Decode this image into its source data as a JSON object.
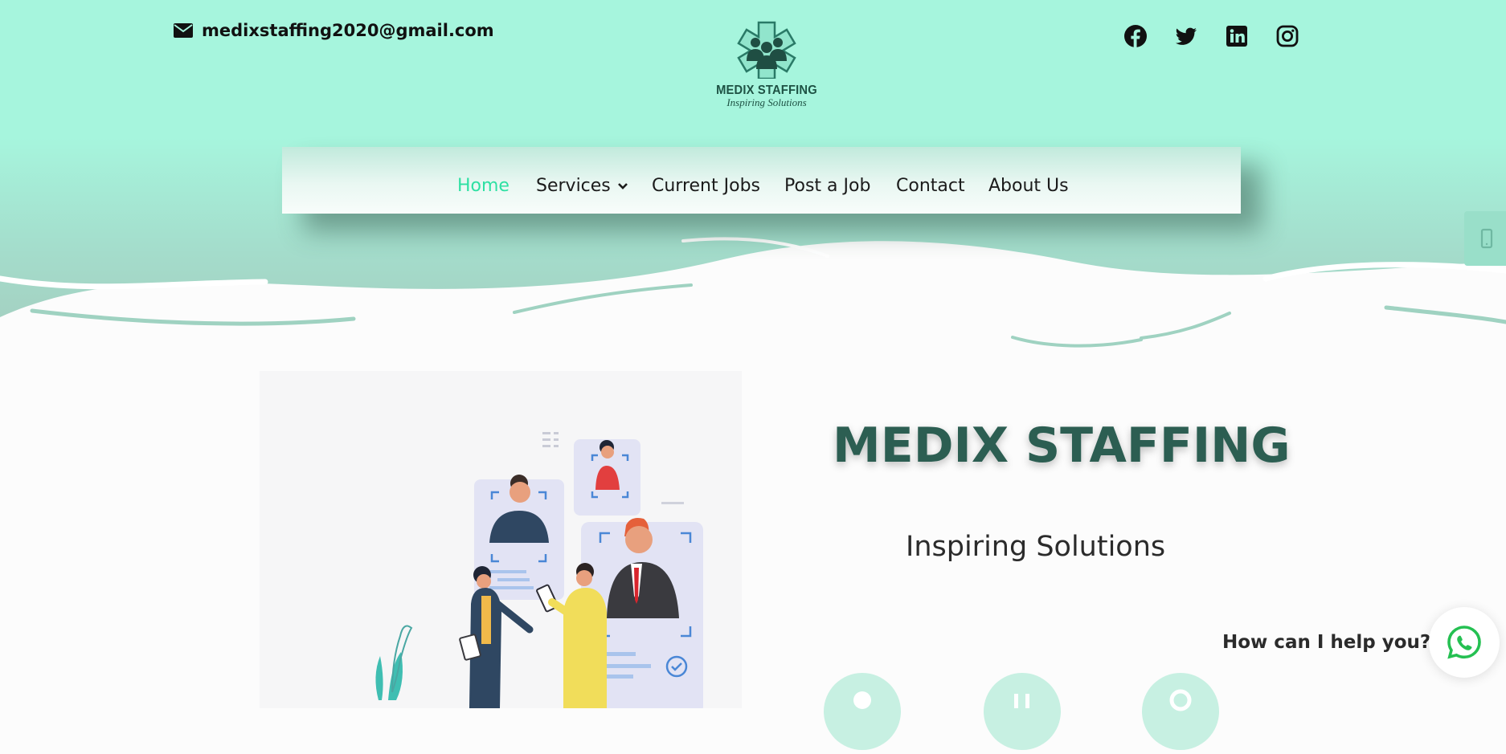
{
  "header": {
    "email": "medixstaffing2020@gmail.com",
    "logo": {
      "name": "MEDIX STAFFING",
      "tagline": "Inspiring Solutions"
    },
    "social": [
      "facebook-icon",
      "twitter-icon",
      "linkedin-icon",
      "instagram-icon"
    ]
  },
  "nav": {
    "items": [
      {
        "label": "Home",
        "active": true
      },
      {
        "label": "Services",
        "has_dropdown": true
      },
      {
        "label": "Current Jobs"
      },
      {
        "label": "Post a Job"
      },
      {
        "label": "Contact"
      },
      {
        "label": "About Us"
      }
    ]
  },
  "hero": {
    "title": "MEDIX STAFFING",
    "subtitle": "Inspiring Solutions"
  },
  "chat": {
    "prompt": "How can I help you?",
    "icon": "whatsapp-icon"
  },
  "colors": {
    "header_bg": "#a6f5dd",
    "active_nav": "#2ee0a3",
    "title": "#2c5e52",
    "whatsapp": "#25c052"
  }
}
